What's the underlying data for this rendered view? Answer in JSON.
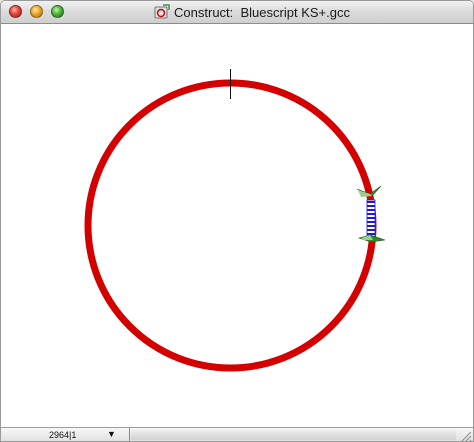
{
  "window": {
    "title": "Construct:  Bluescript KS+.gcc"
  },
  "map": {
    "backbone_color": "#d40000",
    "marker_color": "#111111",
    "insert_stripe_blue": "#1c1ccc",
    "insert_stripe_white": "#ffffff",
    "site_marker_color": "#2e8b2e"
  },
  "statusbar": {
    "position_label": "2964|1",
    "dropdown_icon": "triangle-down-icon"
  }
}
